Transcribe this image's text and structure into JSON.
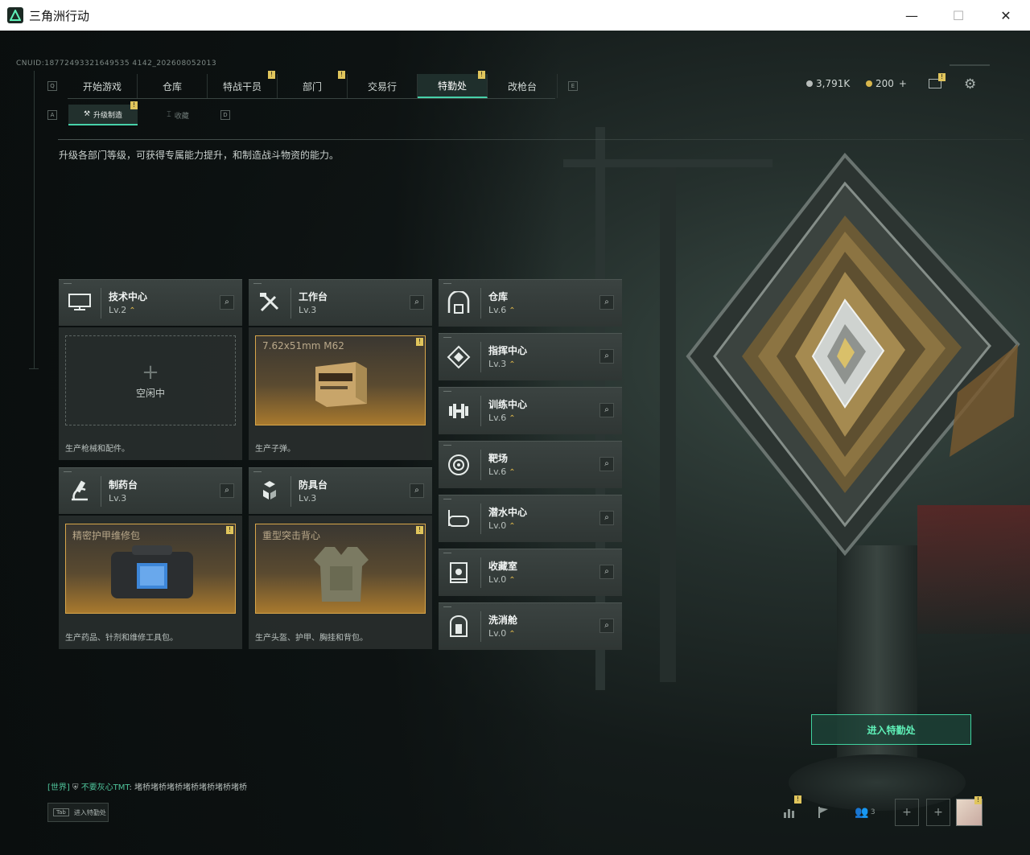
{
  "window": {
    "title": "三角洲行动",
    "min_glyph": "—",
    "max_glyph": "☐",
    "close_glyph": "✕"
  },
  "uid": "CNUID:18772493321649535 4142_202608052013",
  "nav": {
    "key_left": "Q",
    "key_right": "E",
    "tabs": [
      {
        "label": "开始游戏",
        "active": false,
        "badge": ""
      },
      {
        "label": "仓库",
        "active": false,
        "badge": ""
      },
      {
        "label": "特战干员",
        "active": false,
        "badge": "!"
      },
      {
        "label": "部门",
        "active": false,
        "badge": "!"
      },
      {
        "label": "交易行",
        "active": false,
        "badge": ""
      },
      {
        "label": "特勤处",
        "active": true,
        "badge": "!"
      },
      {
        "label": "改枪台",
        "active": false,
        "badge": ""
      }
    ]
  },
  "currency": {
    "silver": "3,791K",
    "gold": "200",
    "gold_plus": "+"
  },
  "mail_badge": "!",
  "subtabs": {
    "key_left": "A",
    "key_right": "D",
    "active": "升级制造",
    "active_badge": "!",
    "inactive": "收藏"
  },
  "description": "升级各部门等级，可获得专属能力提升，和制造战斗物资的能力。",
  "stations": {
    "tech": {
      "name": "技术中心",
      "level": "Lv.2",
      "idle": "空闲中",
      "footer": "生产枪械和配件。"
    },
    "workbench": {
      "name": "工作台",
      "level": "Lv.3",
      "item": "7.62x51mm M62",
      "badge": "!",
      "footer": "生产子弹。"
    },
    "pharmacy": {
      "name": "制药台",
      "level": "Lv.3",
      "item": "精密护甲维修包",
      "badge": "!",
      "footer": "生产药品、针剂和维修工具包。"
    },
    "armor": {
      "name": "防具台",
      "level": "Lv.3",
      "item": "重型突击背心",
      "badge": "!",
      "footer": "生产头盔、护甲、胸挂和背包。"
    }
  },
  "right_stations": [
    {
      "name": "仓库",
      "level": "Lv.6",
      "icon": "warehouse-icon"
    },
    {
      "name": "指挥中心",
      "level": "Lv.3",
      "icon": "command-icon"
    },
    {
      "name": "训练中心",
      "level": "Lv.6",
      "icon": "dumbbell-icon"
    },
    {
      "name": "靶场",
      "level": "Lv.6",
      "icon": "target-icon"
    },
    {
      "name": "潜水中心",
      "level": "Lv.0",
      "icon": "goggles-icon"
    },
    {
      "name": "收藏室",
      "level": "Lv.0",
      "icon": "collection-icon"
    },
    {
      "name": "洗消舱",
      "level": "Lv.0",
      "icon": "decon-icon"
    }
  ],
  "enter_button": "进入特勤处",
  "chat": {
    "channel": "[世界]",
    "user": "不要灰心TMT",
    "message": "堵桥堵桥堵桥堵桥堵桥堵桥堵桥"
  },
  "tab_hint": {
    "key": "Tab",
    "label": "进入特勤处"
  },
  "bottom": {
    "stats_badge": "!",
    "friends_count": "3",
    "avatar_badge": "!"
  },
  "glyphs": {
    "search": "⌕",
    "up": "⌃",
    "plus": "+",
    "gear": "⚙",
    "coin": "●"
  }
}
